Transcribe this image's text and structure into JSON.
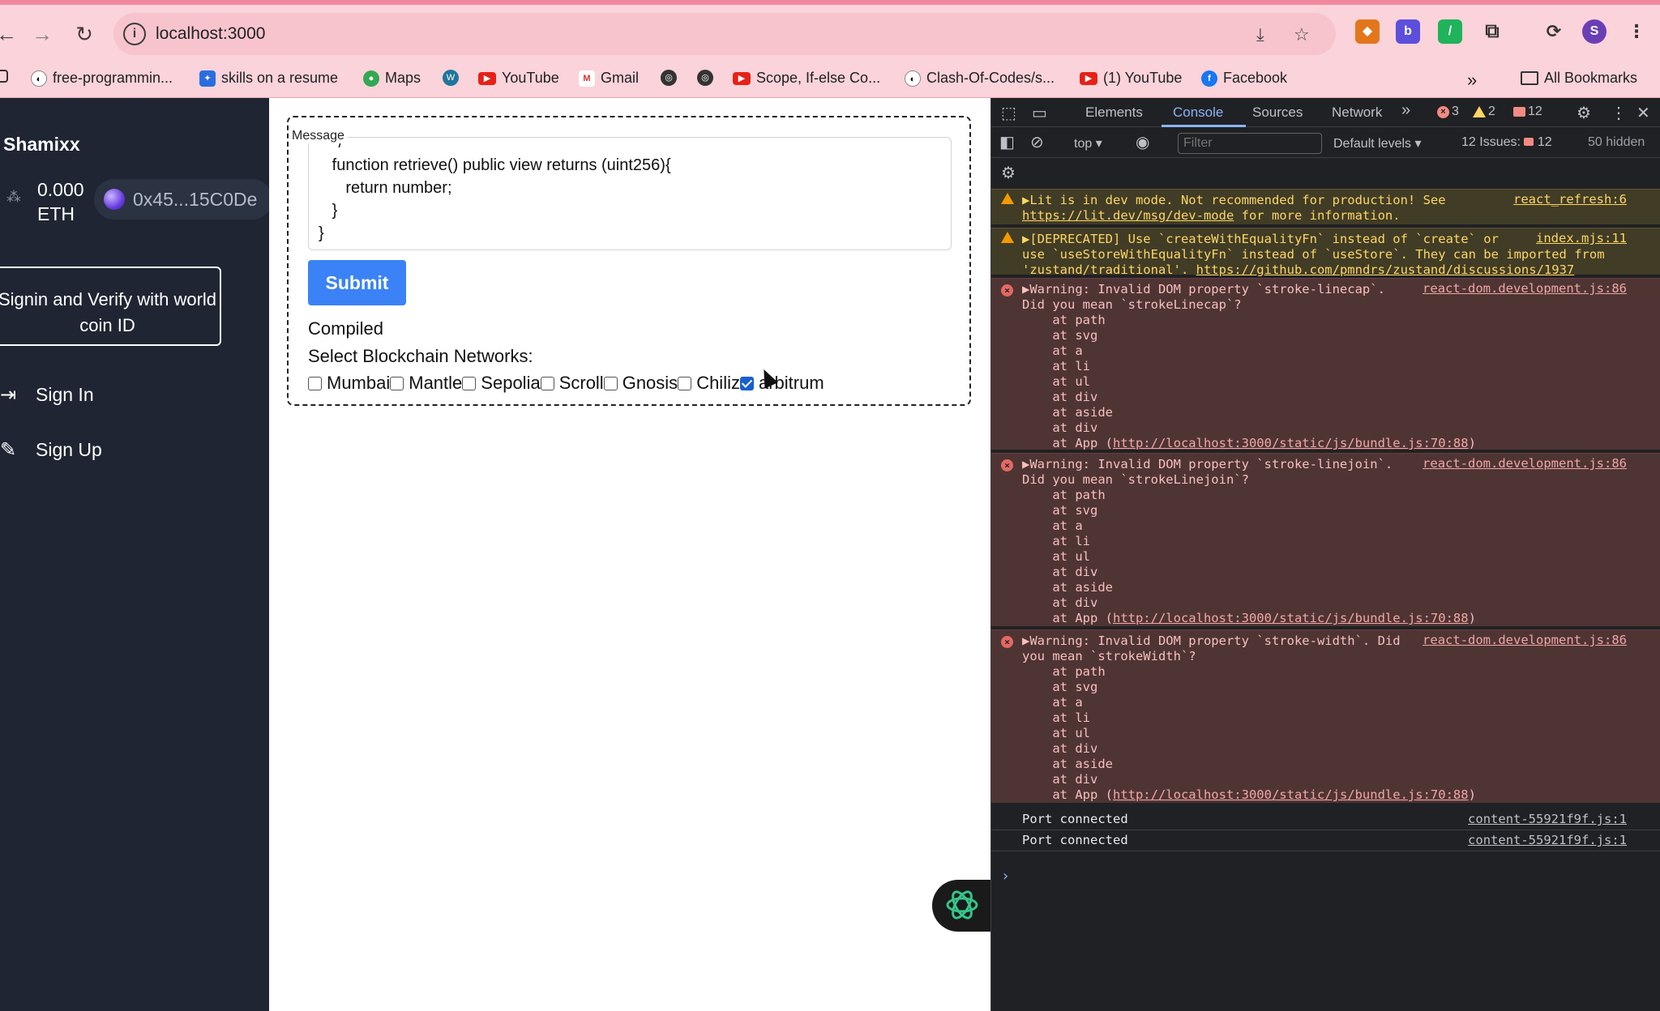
{
  "browser": {
    "url": "localhost:3000",
    "bookmarks": [
      {
        "label": "free-programmin...",
        "icon": "github-icon"
      },
      {
        "label": "skills on a resume",
        "icon": "bookmark-blue-icon"
      },
      {
        "label": "Maps",
        "icon": "maps-pin-icon"
      },
      {
        "label": "",
        "icon": "wordpress-icon"
      },
      {
        "label": "YouTube",
        "icon": "youtube-icon"
      },
      {
        "label": "Gmail",
        "icon": "gmail-icon"
      },
      {
        "label": "",
        "icon": "globe-icon"
      },
      {
        "label": "",
        "icon": "globe-icon"
      },
      {
        "label": "Scope, If-else Co...",
        "icon": "youtube-icon"
      },
      {
        "label": "Clash-Of-Codes/s...",
        "icon": "github-icon"
      },
      {
        "label": "(1) YouTube",
        "icon": "youtube-icon"
      },
      {
        "label": "Facebook",
        "icon": "facebook-icon"
      }
    ],
    "all_bookmarks": "All Bookmarks",
    "profile_initial": "S"
  },
  "sidebar": {
    "brand": "Shamixx",
    "balance_amount": "0.000",
    "balance_unit": "ETH",
    "address": "0x45...15C0De",
    "verify_button": "Signin and Verify with world coin ID",
    "nav": [
      {
        "label": "Sign In",
        "icon": "sign-in-icon"
      },
      {
        "label": "Sign Up",
        "icon": "sign-up-icon"
      }
    ]
  },
  "main": {
    "message_legend": "Message",
    "code_lines": [
      "   */",
      "   function retrieve() public view returns (uint256){",
      "      return number;",
      "   }",
      "}"
    ],
    "submit_label": "Submit",
    "status": "Compiled",
    "select_label": "Select Blockchain Networks:",
    "networks": [
      {
        "label": "Mumbai",
        "checked": false
      },
      {
        "label": "Mantle",
        "checked": false
      },
      {
        "label": "Sepolia",
        "checked": false
      },
      {
        "label": "Scroll",
        "checked": false
      },
      {
        "label": "Gnosis",
        "checked": false
      },
      {
        "label": "Chiliz",
        "checked": false
      },
      {
        "label": "arbitrum",
        "checked": true
      }
    ]
  },
  "devtools": {
    "tabs": [
      "Elements",
      "Console",
      "Sources",
      "Network"
    ],
    "active_tab": "Console",
    "error_count": "3",
    "warning_count": "2",
    "message_count": "12",
    "context": "top",
    "filter_placeholder": "Filter",
    "levels": "Default levels",
    "issues_label": "12 Issues:",
    "issues_count": "12",
    "hidden": "50 hidden",
    "logs": [
      {
        "level": "warn",
        "source": "react_refresh:6",
        "lines": [
          "▶Lit is in dev mode. Not recommended for production! See",
          ""
        ],
        "link": "https://lit.dev/msg/dev-mode",
        "tail": " for more information."
      },
      {
        "level": "warn",
        "source": "index.mjs:11",
        "lines": [
          "▶[DEPRECATED] Use `createWithEqualityFn` instead of `create` or",
          "use `useStoreWithEqualityFn` instead of `useStore`. They can be imported from"
        ],
        "pre_link": "'zustand/traditional'. ",
        "link": "https://github.com/pmndrs/zustand/discussions/1937"
      },
      {
        "level": "error",
        "source": "react-dom.development.js:86",
        "lines": [
          "▶Warning: Invalid DOM property `stroke-linecap`.",
          "Did you mean `strokeLinecap`?",
          "    at path",
          "    at svg",
          "    at a",
          "    at li",
          "    at ul",
          "    at div",
          "    at aside",
          "    at div"
        ],
        "pre_link": "    at App (",
        "link": "http://localhost:3000/static/js/bundle.js:70:88",
        "tail": ")"
      },
      {
        "level": "error",
        "source": "react-dom.development.js:86",
        "lines": [
          "▶Warning: Invalid DOM property `stroke-linejoin`.",
          "Did you mean `strokeLinejoin`?",
          "    at path",
          "    at svg",
          "    at a",
          "    at li",
          "    at ul",
          "    at div",
          "    at aside",
          "    at div"
        ],
        "pre_link": "    at App (",
        "link": "http://localhost:3000/static/js/bundle.js:70:88",
        "tail": ")"
      },
      {
        "level": "error",
        "source": "react-dom.development.js:86",
        "lines": [
          "▶Warning: Invalid DOM property `stroke-width`. Did",
          "you mean `strokeWidth`?",
          "    at path",
          "    at svg",
          "    at a",
          "    at li",
          "    at ul",
          "    at div",
          "    at aside",
          "    at div"
        ],
        "pre_link": "    at App (",
        "link": "http://localhost:3000/static/js/bundle.js:70:88",
        "tail": ")"
      },
      {
        "level": "info",
        "source": "content-55921f9f.js:1",
        "lines": [
          "Port connected"
        ]
      },
      {
        "level": "info",
        "source": "content-55921f9f.js:1",
        "lines": [
          "Port connected"
        ]
      }
    ]
  },
  "colors": {
    "chrome_bg": "#fbd3da",
    "sidebar_bg": "#1f2532",
    "submit_blue": "#3b82f6",
    "devtools_bg": "#202124"
  }
}
